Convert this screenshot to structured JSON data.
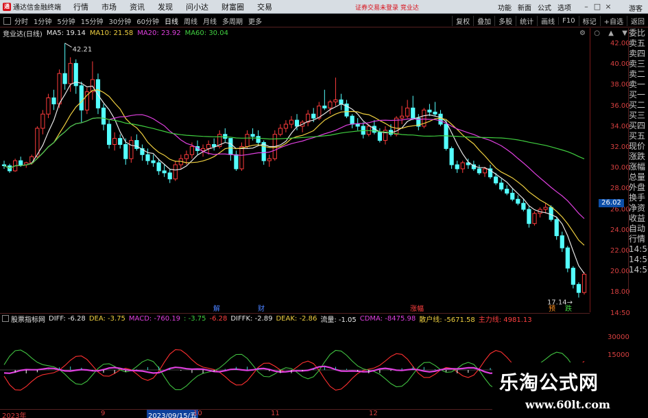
{
  "titlebar": {
    "app_title": "通达信金融终端",
    "menu": [
      "行情",
      "市场",
      "资讯",
      "发现",
      "问小达",
      "财富圈",
      "交易"
    ],
    "login_warning": "证券交易未登录  竞业达",
    "right_menu": [
      "功能",
      "新面",
      "公式",
      "选项"
    ],
    "user": "游客"
  },
  "toolbar": {
    "periods": [
      "分时",
      "1分钟",
      "5分钟",
      "15分钟",
      "30分钟",
      "60分钟",
      "日线",
      "周线",
      "月线",
      "多周期",
      "更多"
    ],
    "active_period": "日线",
    "right_buttons": [
      "复权",
      "叠加",
      "多股",
      "统计",
      "画线",
      "F10",
      "标记",
      "+自选",
      "返回"
    ]
  },
  "chart": {
    "stock_name": "竞业达(日线)",
    "ma": [
      {
        "label": "MA5: 19.14",
        "color": "#e8e8e8"
      },
      {
        "label": "MA10: 21.58",
        "color": "#f0d040"
      },
      {
        "label": "MA20: 23.92",
        "color": "#e040e0"
      },
      {
        "label": "MA60: 30.04",
        "color": "#40d040"
      }
    ],
    "high_label": "42.21",
    "low_label": "17.14",
    "current_price": "26.02",
    "y_ticks": [
      "42.00",
      "40.00",
      "38.00",
      "36.00",
      "34.00",
      "32.00",
      "30.00",
      "28.00",
      "26.00",
      "24.00",
      "22.00",
      "20.00",
      "18.00",
      "14:50"
    ],
    "events": [
      {
        "text": "解",
        "color": "#4a80ff"
      },
      {
        "text": "财",
        "color": "#4a80ff"
      },
      {
        "text": "涨幅",
        "color": "#ff4040"
      },
      {
        "text": "预",
        "color": "#ff9020"
      },
      {
        "text": "跌",
        "color": "#40d040"
      }
    ],
    "colors": {
      "up": "#ff3c3c",
      "down": "#54ffff",
      "ma5": "#e8e8e8",
      "ma10": "#f0d040",
      "ma20": "#e040e0",
      "ma60": "#40d040"
    }
  },
  "chart_data": {
    "type": "candlestick",
    "title": "竞业达(日线)",
    "ylim": [
      17,
      43
    ],
    "series": [
      {
        "name": "K",
        "ohlc": [
          [
            30.2,
            30.6,
            29.8,
            30.1
          ],
          [
            30.1,
            30.3,
            29.4,
            29.6
          ],
          [
            29.6,
            30.8,
            29.5,
            30.6
          ],
          [
            30.6,
            31.0,
            30.0,
            30.2
          ],
          [
            30.2,
            30.5,
            29.9,
            30.4
          ],
          [
            30.4,
            31.2,
            30.2,
            31.0
          ],
          [
            31.0,
            34.0,
            30.8,
            33.8
          ],
          [
            33.8,
            35.6,
            33.2,
            35.2
          ],
          [
            35.2,
            37.2,
            34.8,
            36.8
          ],
          [
            36.8,
            37.6,
            35.6,
            36.2
          ],
          [
            36.2,
            39.6,
            35.8,
            39.2
          ],
          [
            39.2,
            42.2,
            37.6,
            38.2
          ],
          [
            38.2,
            40.8,
            37.4,
            40.2
          ],
          [
            40.2,
            40.6,
            37.2,
            38.0
          ],
          [
            38.0,
            38.4,
            34.4,
            35.6
          ],
          [
            35.6,
            37.8,
            35.2,
            37.4
          ],
          [
            37.4,
            40.4,
            36.6,
            38.6
          ],
          [
            38.6,
            39.2,
            35.2,
            35.8
          ],
          [
            35.8,
            36.2,
            33.6,
            34.2
          ],
          [
            34.2,
            34.6,
            31.8,
            32.2
          ],
          [
            32.2,
            33.4,
            31.6,
            32.8
          ],
          [
            32.8,
            33.2,
            31.8,
            32.2
          ],
          [
            32.2,
            32.8,
            30.2,
            30.8
          ],
          [
            30.8,
            33.0,
            30.4,
            32.6
          ],
          [
            32.6,
            33.2,
            31.6,
            31.8
          ],
          [
            31.8,
            32.2,
            30.6,
            31.2
          ],
          [
            31.2,
            31.8,
            30.2,
            30.6
          ],
          [
            30.6,
            31.2,
            30.0,
            30.4
          ],
          [
            30.4,
            30.8,
            29.2,
            29.6
          ],
          [
            29.6,
            30.2,
            29.0,
            29.4
          ],
          [
            29.4,
            29.8,
            28.4,
            28.8
          ],
          [
            28.8,
            30.6,
            28.6,
            30.2
          ],
          [
            30.2,
            31.2,
            29.8,
            30.8
          ],
          [
            30.8,
            31.6,
            30.2,
            31.2
          ],
          [
            31.2,
            32.4,
            30.8,
            32.0
          ],
          [
            32.0,
            32.6,
            31.2,
            31.6
          ],
          [
            31.6,
            32.2,
            31.0,
            31.8
          ],
          [
            31.8,
            32.6,
            31.2,
            32.2
          ],
          [
            32.2,
            32.8,
            31.6,
            32.0
          ],
          [
            32.0,
            33.6,
            31.8,
            33.2
          ],
          [
            33.2,
            33.8,
            32.4,
            32.8
          ],
          [
            32.8,
            32.4,
            30.6,
            31.2
          ],
          [
            31.2,
            31.6,
            29.6,
            29.8
          ],
          [
            29.8,
            32.4,
            29.6,
            32.0
          ],
          [
            32.0,
            33.6,
            31.8,
            33.2
          ],
          [
            33.2,
            33.8,
            32.6,
            33.0
          ],
          [
            33.0,
            33.6,
            32.2,
            32.4
          ],
          [
            32.4,
            32.6,
            30.2,
            30.6
          ],
          [
            30.6,
            31.2,
            30.0,
            30.8
          ],
          [
            30.8,
            33.6,
            30.6,
            33.2
          ],
          [
            33.2,
            34.2,
            33.0,
            33.8
          ],
          [
            33.8,
            34.6,
            33.4,
            34.2
          ],
          [
            34.2,
            35.0,
            33.8,
            34.6
          ],
          [
            34.6,
            35.2,
            33.6,
            34.0
          ],
          [
            34.0,
            34.6,
            33.4,
            34.4
          ],
          [
            34.4,
            35.6,
            34.0,
            35.2
          ],
          [
            35.2,
            35.8,
            34.4,
            34.8
          ],
          [
            34.8,
            36.4,
            34.6,
            36.0
          ],
          [
            36.0,
            37.6,
            35.6,
            35.8
          ],
          [
            35.8,
            36.6,
            35.2,
            36.4
          ],
          [
            36.4,
            38.8,
            36.0,
            36.6
          ],
          [
            36.6,
            37.2,
            35.6,
            36.2
          ],
          [
            36.2,
            36.6,
            34.8,
            35.0
          ],
          [
            35.0,
            35.2,
            33.8,
            34.2
          ],
          [
            34.2,
            34.8,
            33.6,
            34.0
          ],
          [
            34.0,
            34.4,
            32.8,
            33.2
          ],
          [
            33.2,
            34.2,
            33.0,
            34.0
          ],
          [
            34.0,
            34.6,
            33.2,
            33.4
          ],
          [
            33.4,
            33.8,
            32.4,
            32.6
          ],
          [
            32.6,
            34.0,
            32.2,
            33.6
          ],
          [
            33.6,
            34.2,
            33.0,
            33.2
          ],
          [
            33.2,
            35.0,
            33.0,
            34.8
          ],
          [
            34.8,
            36.0,
            34.2,
            35.0
          ],
          [
            35.0,
            36.6,
            34.8,
            35.8
          ],
          [
            35.8,
            37.0,
            34.6,
            34.8
          ],
          [
            34.8,
            35.2,
            33.6,
            34.0
          ],
          [
            34.0,
            35.8,
            33.8,
            35.6
          ],
          [
            35.6,
            36.2,
            35.0,
            35.4
          ],
          [
            35.4,
            36.4,
            35.0,
            35.2
          ],
          [
            35.2,
            35.6,
            34.0,
            34.2
          ],
          [
            34.2,
            34.6,
            31.6,
            31.8
          ],
          [
            31.8,
            32.0,
            29.8,
            30.2
          ],
          [
            30.2,
            30.6,
            29.4,
            29.8
          ],
          [
            29.8,
            30.6,
            29.4,
            30.4
          ],
          [
            30.4,
            30.8,
            29.8,
            30.2
          ],
          [
            30.2,
            30.6,
            29.6,
            29.8
          ],
          [
            29.8,
            30.2,
            29.2,
            29.4
          ],
          [
            29.4,
            30.0,
            29.0,
            29.8
          ],
          [
            29.8,
            30.2,
            28.8,
            29.0
          ],
          [
            29.0,
            29.4,
            28.2,
            28.4
          ],
          [
            28.4,
            28.8,
            27.6,
            27.8
          ],
          [
            27.8,
            28.2,
            27.2,
            27.4
          ],
          [
            27.4,
            27.8,
            26.6,
            26.8
          ],
          [
            26.8,
            27.2,
            26.2,
            26.4
          ],
          [
            26.4,
            26.8,
            25.6,
            25.8
          ],
          [
            25.8,
            26.2,
            24.0,
            24.4
          ],
          [
            24.4,
            25.6,
            24.2,
            25.4
          ],
          [
            25.4,
            26.0,
            25.0,
            25.8
          ],
          [
            25.8,
            26.4,
            25.4,
            26.0
          ],
          [
            26.0,
            26.2,
            24.6,
            24.8
          ],
          [
            24.8,
            25.0,
            22.8,
            23.2
          ],
          [
            23.2,
            23.6,
            21.6,
            22.0
          ],
          [
            22.0,
            22.2,
            19.6,
            20.0
          ],
          [
            20.0,
            20.2,
            18.0,
            18.4
          ],
          [
            18.4,
            18.6,
            17.1,
            17.6
          ],
          [
            17.6,
            19.6,
            17.4,
            19.4
          ]
        ]
      },
      {
        "name": "MA5"
      },
      {
        "name": "MA10"
      },
      {
        "name": "MA20"
      },
      {
        "name": "MA60"
      }
    ]
  },
  "indicator": {
    "title": "股票指标网",
    "items": [
      {
        "label": "DIFF: -6.28",
        "color": "#e8e8e8"
      },
      {
        "label": "DEA: -3.75",
        "color": "#f0d040"
      },
      {
        "label": "MACD: -760.19",
        "color": "#e040e0"
      },
      {
        "label": ": -3.75",
        "color": "#40d040"
      },
      {
        "label": "-6.28",
        "color": "#ff4040"
      },
      {
        "label": "DIFFK: -2.89",
        "color": "#e8e8e8"
      },
      {
        "label": "DEAK: -2.86",
        "color": "#f0d040"
      },
      {
        "label": "流量: -1.05",
        "color": "#e8e8e8"
      },
      {
        "label": "CDMA: -8475.98",
        "color": "#e040e0"
      },
      {
        "label": "散户线: -5671.58",
        "color": "#f0d040"
      },
      {
        "label": "主力线: 4981.13",
        "color": "#ff4040"
      }
    ],
    "y_ticks": [
      "30000",
      "15000"
    ]
  },
  "date_axis": {
    "labels": [
      "2023年",
      "9",
      "2023/09/15/五",
      "10",
      "11",
      "12"
    ]
  },
  "side_panel": [
    "委比",
    "卖五",
    "卖四",
    "卖三",
    "卖二",
    "卖一",
    "买一",
    "买二",
    "买三",
    "买四",
    "买五",
    "现价",
    "涨跌",
    "涨幅",
    "总量",
    "外盘",
    "换手",
    "净资",
    "收益",
    "自动",
    "行情",
    "14:50",
    "14:50",
    "14:50"
  ],
  "watermark": {
    "line1": "乐淘公式网",
    "line2": "www.60lt.com"
  }
}
